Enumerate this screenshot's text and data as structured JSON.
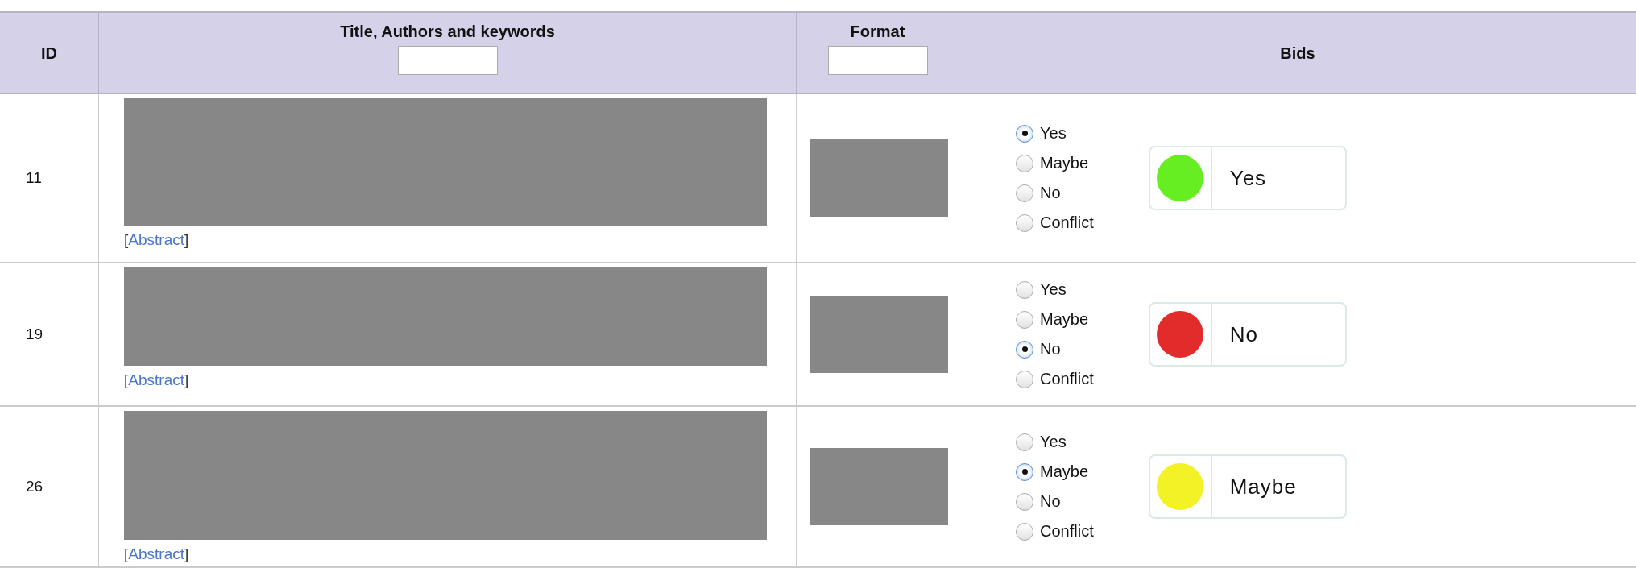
{
  "table": {
    "columns": [
      {
        "label": "ID",
        "filter": false
      },
      {
        "label": "Title, Authors and keywords",
        "filter": true
      },
      {
        "label": "Format",
        "filter": true
      },
      {
        "label": "Bids",
        "filter": false
      }
    ],
    "rows": [
      {
        "id": "11",
        "abstract": {
          "open": "[",
          "link": "Abstract",
          "close": "]"
        },
        "options": [
          {
            "label": "Yes",
            "selected": true
          },
          {
            "label": "Maybe",
            "selected": false
          },
          {
            "label": "No",
            "selected": false
          },
          {
            "label": "Conflict",
            "selected": false
          }
        ],
        "bid": {
          "label": "Yes",
          "color": "#66ee22"
        }
      },
      {
        "id": "19",
        "abstract": {
          "open": "[",
          "link": "Abstract",
          "close": "]"
        },
        "options": [
          {
            "label": "Yes",
            "selected": false
          },
          {
            "label": "Maybe",
            "selected": false
          },
          {
            "label": "No",
            "selected": true
          },
          {
            "label": "Conflict",
            "selected": false
          }
        ],
        "bid": {
          "label": "No",
          "color": "#e22b2b"
        }
      },
      {
        "id": "26",
        "abstract": {
          "open": "[",
          "link": "Abstract",
          "close": "]"
        },
        "options": [
          {
            "label": "Yes",
            "selected": false
          },
          {
            "label": "Maybe",
            "selected": true
          },
          {
            "label": "No",
            "selected": false
          },
          {
            "label": "Conflict",
            "selected": false
          }
        ],
        "bid": {
          "label": "Maybe",
          "color": "#f2f226"
        }
      }
    ]
  }
}
